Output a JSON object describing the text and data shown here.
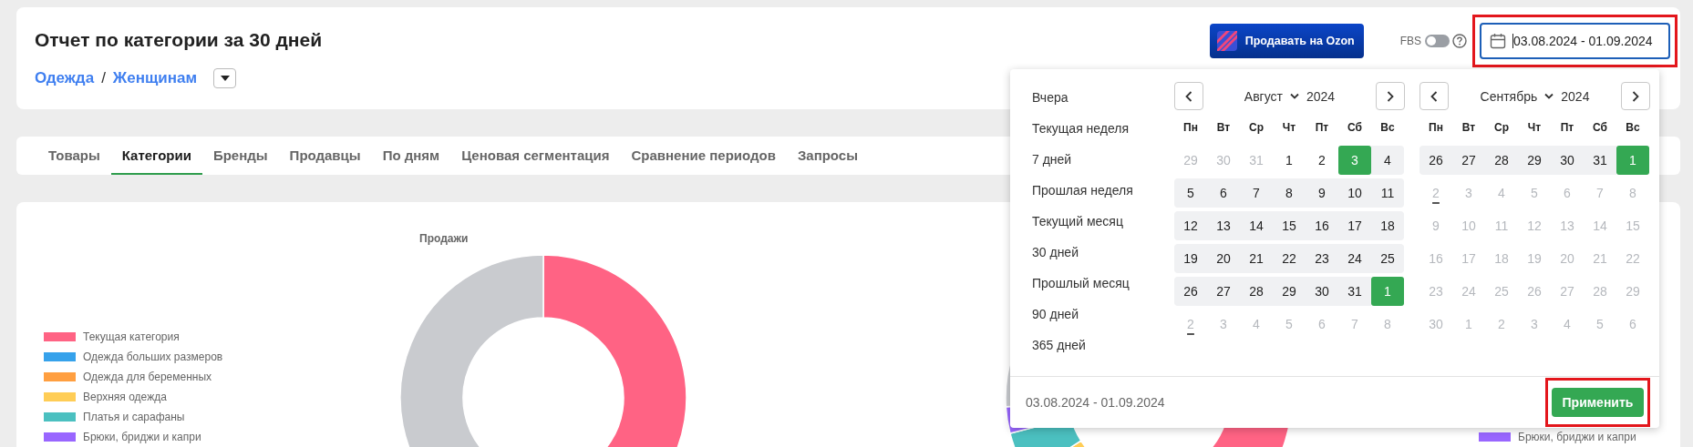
{
  "header": {
    "title": "Отчет по категории за 30 дней",
    "breadcrumbs": {
      "items": [
        "Одежда",
        "Женщинам"
      ],
      "separator": "/"
    },
    "sell_button": "Продавать на Ozon",
    "fbs_toggle": {
      "label": "FBS",
      "on": false
    },
    "date_field": {
      "value": "03.08.2024 - 01.09.2024"
    }
  },
  "tabs": [
    {
      "label": "Товары",
      "selected": false
    },
    {
      "label": "Категории",
      "selected": true
    },
    {
      "label": "Бренды",
      "selected": false
    },
    {
      "label": "Продавцы",
      "selected": false
    },
    {
      "label": "По дням",
      "selected": false
    },
    {
      "label": "Ценовая сегментация",
      "selected": false
    },
    {
      "label": "Сравнение периодов",
      "selected": false
    },
    {
      "label": "Запросы",
      "selected": false
    }
  ],
  "charts": {
    "left": {
      "title": "Продажи",
      "legend": [
        {
          "label": "Текущая категория",
          "color": "#ff6384"
        },
        {
          "label": "Одежда больших размеров",
          "color": "#36a2eb"
        },
        {
          "label": "Одежда для беременных",
          "color": "#ff9f40"
        },
        {
          "label": "Верхняя одежда",
          "color": "#ffcd56"
        },
        {
          "label": "Платья и сарафаны",
          "color": "#4bc0c0"
        },
        {
          "label": "Брюки, бриджи и капри",
          "color": "#9966ff"
        }
      ]
    },
    "right": {
      "legend": [
        {
          "label": "Брюки, бриджи и капри",
          "color": "#9966ff"
        }
      ]
    }
  },
  "calendar": {
    "presets": [
      {
        "label": "Вчера",
        "selected": false
      },
      {
        "label": "Текущая неделя",
        "selected": false
      },
      {
        "label": "7 дней",
        "selected": false
      },
      {
        "label": "Прошлая неделя",
        "selected": false
      },
      {
        "label": "Текущий месяц",
        "selected": false
      },
      {
        "label": "30 дней",
        "selected": false
      },
      {
        "label": "Прошлый месяц",
        "selected": false
      },
      {
        "label": "90 дней",
        "selected": false
      },
      {
        "label": "365 дней",
        "selected": false
      }
    ],
    "months": [
      {
        "month": "Август",
        "year": "2024",
        "weekdays": [
          "Пн",
          "Вт",
          "Ср",
          "Чт",
          "Пт",
          "Сб",
          "Вс"
        ],
        "weeks": [
          [
            {
              "day": "29",
              "disabled": true,
              "in_range": false,
              "selected": false,
              "today": false
            },
            {
              "day": "30",
              "disabled": true,
              "in_range": false,
              "selected": false,
              "today": false
            },
            {
              "day": "31",
              "disabled": true,
              "in_range": false,
              "selected": false,
              "today": false
            },
            {
              "day": "1",
              "disabled": false,
              "in_range": false,
              "selected": false,
              "today": false
            },
            {
              "day": "2",
              "disabled": false,
              "in_range": false,
              "selected": false,
              "today": false
            },
            {
              "day": "3",
              "disabled": false,
              "in_range": true,
              "selected": true,
              "today": false
            },
            {
              "day": "4",
              "disabled": false,
              "in_range": true,
              "selected": false,
              "today": false
            }
          ],
          [
            {
              "day": "5",
              "disabled": false,
              "in_range": true,
              "selected": false,
              "today": false
            },
            {
              "day": "6",
              "disabled": false,
              "in_range": true,
              "selected": false,
              "today": false
            },
            {
              "day": "7",
              "disabled": false,
              "in_range": true,
              "selected": false,
              "today": false
            },
            {
              "day": "8",
              "disabled": false,
              "in_range": true,
              "selected": false,
              "today": false
            },
            {
              "day": "9",
              "disabled": false,
              "in_range": true,
              "selected": false,
              "today": false
            },
            {
              "day": "10",
              "disabled": false,
              "in_range": true,
              "selected": false,
              "today": false
            },
            {
              "day": "11",
              "disabled": false,
              "in_range": true,
              "selected": false,
              "today": false
            }
          ],
          [
            {
              "day": "12",
              "disabled": false,
              "in_range": true,
              "selected": false,
              "today": false
            },
            {
              "day": "13",
              "disabled": false,
              "in_range": true,
              "selected": false,
              "today": false
            },
            {
              "day": "14",
              "disabled": false,
              "in_range": true,
              "selected": false,
              "today": false
            },
            {
              "day": "15",
              "disabled": false,
              "in_range": true,
              "selected": false,
              "today": false
            },
            {
              "day": "16",
              "disabled": false,
              "in_range": true,
              "selected": false,
              "today": false
            },
            {
              "day": "17",
              "disabled": false,
              "in_range": true,
              "selected": false,
              "today": false
            },
            {
              "day": "18",
              "disabled": false,
              "in_range": true,
              "selected": false,
              "today": false
            }
          ],
          [
            {
              "day": "19",
              "disabled": false,
              "in_range": true,
              "selected": false,
              "today": false
            },
            {
              "day": "20",
              "disabled": false,
              "in_range": true,
              "selected": false,
              "today": false
            },
            {
              "day": "21",
              "disabled": false,
              "in_range": true,
              "selected": false,
              "today": false
            },
            {
              "day": "22",
              "disabled": false,
              "in_range": true,
              "selected": false,
              "today": false
            },
            {
              "day": "23",
              "disabled": false,
              "in_range": true,
              "selected": false,
              "today": false
            },
            {
              "day": "24",
              "disabled": false,
              "in_range": true,
              "selected": false,
              "today": false
            },
            {
              "day": "25",
              "disabled": false,
              "in_range": true,
              "selected": false,
              "today": false
            }
          ],
          [
            {
              "day": "26",
              "disabled": false,
              "in_range": true,
              "selected": false,
              "today": false
            },
            {
              "day": "27",
              "disabled": false,
              "in_range": true,
              "selected": false,
              "today": false
            },
            {
              "day": "28",
              "disabled": false,
              "in_range": true,
              "selected": false,
              "today": false
            },
            {
              "day": "29",
              "disabled": false,
              "in_range": true,
              "selected": false,
              "today": false
            },
            {
              "day": "30",
              "disabled": false,
              "in_range": true,
              "selected": false,
              "today": false
            },
            {
              "day": "31",
              "disabled": false,
              "in_range": true,
              "selected": false,
              "today": false
            },
            {
              "day": "1",
              "disabled": false,
              "in_range": true,
              "selected": true,
              "today": false
            }
          ],
          [
            {
              "day": "2",
              "disabled": true,
              "in_range": false,
              "selected": false,
              "today": true
            },
            {
              "day": "3",
              "disabled": true,
              "in_range": false,
              "selected": false,
              "today": false
            },
            {
              "day": "4",
              "disabled": true,
              "in_range": false,
              "selected": false,
              "today": false
            },
            {
              "day": "5",
              "disabled": true,
              "in_range": false,
              "selected": false,
              "today": false
            },
            {
              "day": "6",
              "disabled": true,
              "in_range": false,
              "selected": false,
              "today": false
            },
            {
              "day": "7",
              "disabled": true,
              "in_range": false,
              "selected": false,
              "today": false
            },
            {
              "day": "8",
              "disabled": true,
              "in_range": false,
              "selected": false,
              "today": false
            }
          ]
        ]
      },
      {
        "month": "Сентябрь",
        "year": "2024",
        "weekdays": [
          "Пн",
          "Вт",
          "Ср",
          "Чт",
          "Пт",
          "Сб",
          "Вс"
        ],
        "weeks": [
          [
            {
              "day": "26",
              "disabled": false,
              "in_range": true,
              "selected": false,
              "today": false
            },
            {
              "day": "27",
              "disabled": false,
              "in_range": true,
              "selected": false,
              "today": false
            },
            {
              "day": "28",
              "disabled": false,
              "in_range": true,
              "selected": false,
              "today": false
            },
            {
              "day": "29",
              "disabled": false,
              "in_range": true,
              "selected": false,
              "today": false
            },
            {
              "day": "30",
              "disabled": false,
              "in_range": true,
              "selected": false,
              "today": false
            },
            {
              "day": "31",
              "disabled": false,
              "in_range": true,
              "selected": false,
              "today": false
            },
            {
              "day": "1",
              "disabled": false,
              "in_range": true,
              "selected": true,
              "today": false
            }
          ],
          [
            {
              "day": "2",
              "disabled": true,
              "in_range": false,
              "selected": false,
              "today": true
            },
            {
              "day": "3",
              "disabled": true,
              "in_range": false,
              "selected": false,
              "today": false
            },
            {
              "day": "4",
              "disabled": true,
              "in_range": false,
              "selected": false,
              "today": false
            },
            {
              "day": "5",
              "disabled": true,
              "in_range": false,
              "selected": false,
              "today": false
            },
            {
              "day": "6",
              "disabled": true,
              "in_range": false,
              "selected": false,
              "today": false
            },
            {
              "day": "7",
              "disabled": true,
              "in_range": false,
              "selected": false,
              "today": false
            },
            {
              "day": "8",
              "disabled": true,
              "in_range": false,
              "selected": false,
              "today": false
            }
          ],
          [
            {
              "day": "9",
              "disabled": true,
              "in_range": false,
              "selected": false,
              "today": false
            },
            {
              "day": "10",
              "disabled": true,
              "in_range": false,
              "selected": false,
              "today": false
            },
            {
              "day": "11",
              "disabled": true,
              "in_range": false,
              "selected": false,
              "today": false
            },
            {
              "day": "12",
              "disabled": true,
              "in_range": false,
              "selected": false,
              "today": false
            },
            {
              "day": "13",
              "disabled": true,
              "in_range": false,
              "selected": false,
              "today": false
            },
            {
              "day": "14",
              "disabled": true,
              "in_range": false,
              "selected": false,
              "today": false
            },
            {
              "day": "15",
              "disabled": true,
              "in_range": false,
              "selected": false,
              "today": false
            }
          ],
          [
            {
              "day": "16",
              "disabled": true,
              "in_range": false,
              "selected": false,
              "today": false
            },
            {
              "day": "17",
              "disabled": true,
              "in_range": false,
              "selected": false,
              "today": false
            },
            {
              "day": "18",
              "disabled": true,
              "in_range": false,
              "selected": false,
              "today": false
            },
            {
              "day": "19",
              "disabled": true,
              "in_range": false,
              "selected": false,
              "today": false
            },
            {
              "day": "20",
              "disabled": true,
              "in_range": false,
              "selected": false,
              "today": false
            },
            {
              "day": "21",
              "disabled": true,
              "in_range": false,
              "selected": false,
              "today": false
            },
            {
              "day": "22",
              "disabled": true,
              "in_range": false,
              "selected": false,
              "today": false
            }
          ],
          [
            {
              "day": "23",
              "disabled": true,
              "in_range": false,
              "selected": false,
              "today": false
            },
            {
              "day": "24",
              "disabled": true,
              "in_range": false,
              "selected": false,
              "today": false
            },
            {
              "day": "25",
              "disabled": true,
              "in_range": false,
              "selected": false,
              "today": false
            },
            {
              "day": "26",
              "disabled": true,
              "in_range": false,
              "selected": false,
              "today": false
            },
            {
              "day": "27",
              "disabled": true,
              "in_range": false,
              "selected": false,
              "today": false
            },
            {
              "day": "28",
              "disabled": true,
              "in_range": false,
              "selected": false,
              "today": false
            },
            {
              "day": "29",
              "disabled": true,
              "in_range": false,
              "selected": false,
              "today": false
            }
          ],
          [
            {
              "day": "30",
              "disabled": true,
              "in_range": false,
              "selected": false,
              "today": false
            },
            {
              "day": "1",
              "disabled": true,
              "in_range": false,
              "selected": false,
              "today": false
            },
            {
              "day": "2",
              "disabled": true,
              "in_range": false,
              "selected": false,
              "today": false
            },
            {
              "day": "3",
              "disabled": true,
              "in_range": false,
              "selected": false,
              "today": false
            },
            {
              "day": "4",
              "disabled": true,
              "in_range": false,
              "selected": false,
              "today": false
            },
            {
              "day": "5",
              "disabled": true,
              "in_range": false,
              "selected": false,
              "today": false
            },
            {
              "day": "6",
              "disabled": true,
              "in_range": false,
              "selected": false,
              "today": false
            }
          ]
        ]
      }
    ],
    "range_text": "03.08.2024 - 01.09.2024",
    "apply_button": "Применить"
  }
}
